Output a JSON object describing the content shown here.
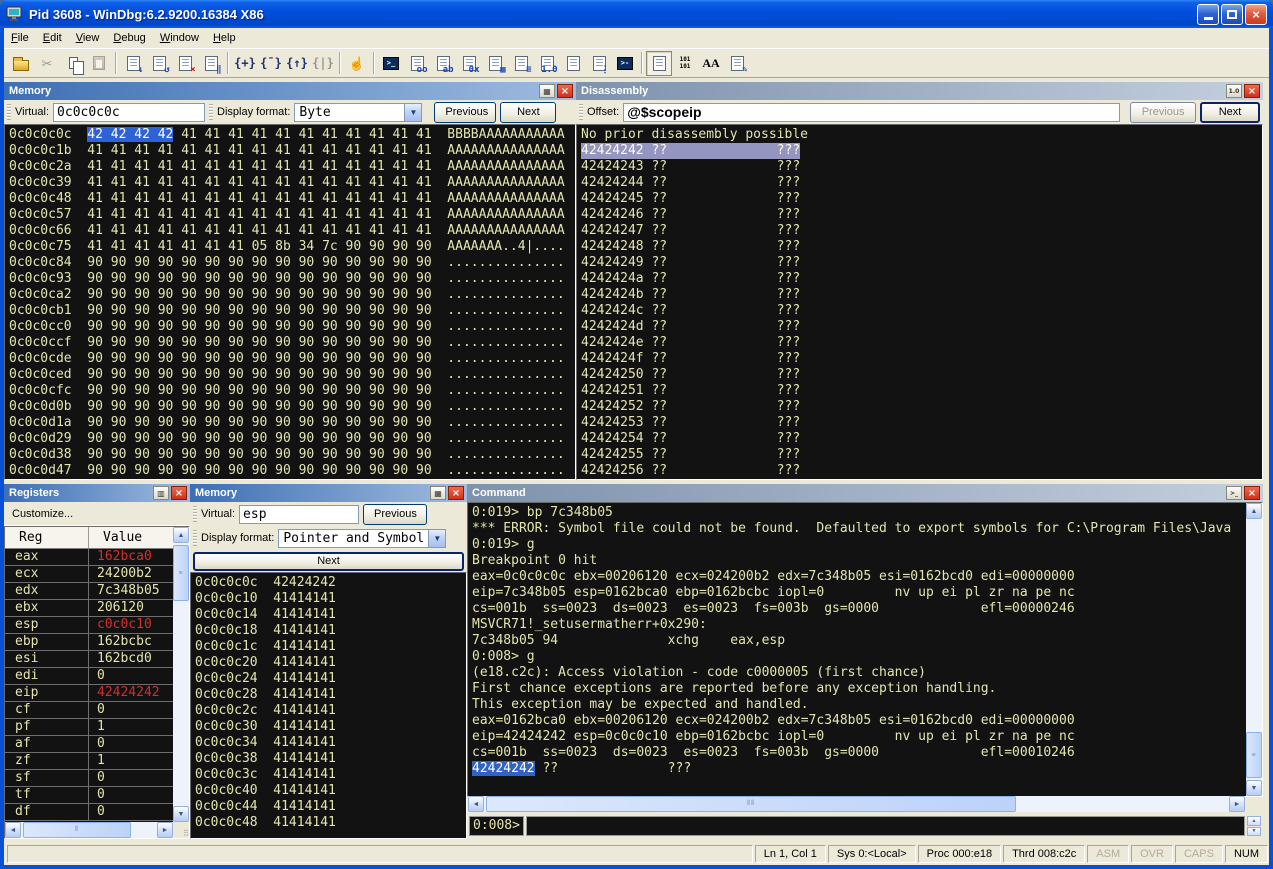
{
  "colors": {
    "frame_blue": "#0851d6",
    "content_bg": "#121212",
    "content_fg": "#e4e4ae",
    "sel_blue": "#2e63d8",
    "disasm_hl": "#9595c1",
    "cmd_sel": "#3163c6",
    "value_red": "#d22f2f",
    "pane_active_1": "#3d6fb4",
    "pane_active_2": "#9fbce0",
    "pane_inactive_1": "#7e92ad",
    "pane_inactive_2": "#c3cfdd"
  },
  "window": {
    "title": "Pid 3608 - WinDbg:6.2.9200.16384 X86",
    "buttons": {
      "minimize": "minimize",
      "maximize": "maximize",
      "close": "close"
    }
  },
  "menu": {
    "items": [
      {
        "label": "File"
      },
      {
        "label": "Edit"
      },
      {
        "label": "View"
      },
      {
        "label": "Debug"
      },
      {
        "label": "Window"
      },
      {
        "label": "Help"
      }
    ]
  },
  "toolbar": {
    "items": [
      {
        "name": "open-source-file",
        "type": "folder"
      },
      {
        "name": "cut",
        "type": "glyph",
        "glyph": "✂",
        "disabled": true
      },
      {
        "name": "copy",
        "type": "copy"
      },
      {
        "name": "paste",
        "type": "paste",
        "disabled": true
      },
      {
        "sep": true
      },
      {
        "name": "go",
        "type": "doc",
        "glyph": "↓"
      },
      {
        "name": "restart",
        "type": "doc",
        "glyph": "↺"
      },
      {
        "name": "stop-debugging",
        "type": "doc",
        "glyph": "×",
        "red": true
      },
      {
        "name": "break",
        "type": "doc",
        "glyph": "‖"
      },
      {
        "sep": true
      },
      {
        "name": "step-into",
        "type": "brace",
        "glyph": "{+}"
      },
      {
        "name": "step-over",
        "type": "brace",
        "glyph": "{¯}"
      },
      {
        "name": "step-out",
        "type": "brace",
        "glyph": "{↑}"
      },
      {
        "name": "run-to-cursor",
        "type": "brace",
        "glyph": "{|}",
        "disabled": true
      },
      {
        "sep": true
      },
      {
        "name": "break-hand",
        "type": "glyph",
        "glyph": "☝"
      },
      {
        "sep": true
      },
      {
        "name": "command-window",
        "type": "dark",
        "glyph": ">_"
      },
      {
        "name": "watch-window",
        "type": "doc",
        "glyph": "oo"
      },
      {
        "name": "locals-window",
        "type": "doc",
        "glyph": "ab"
      },
      {
        "name": "registers-window",
        "type": "doc",
        "glyph": "0x"
      },
      {
        "name": "memory-window",
        "type": "doc",
        "glyph": "▦"
      },
      {
        "name": "call-stack-window",
        "type": "doc",
        "glyph": "≡"
      },
      {
        "name": "disassembly-window",
        "type": "doc",
        "glyph": "1.0"
      },
      {
        "name": "scratch-pad-window",
        "type": "doc",
        "glyph": ""
      },
      {
        "name": "processes-window",
        "type": "doc",
        "glyph": "⋮"
      },
      {
        "name": "command-browser-window",
        "type": "dark",
        "glyph": ">-"
      },
      {
        "sep": true
      },
      {
        "name": "source-mode-on",
        "type": "doc",
        "glyph": "",
        "pressed": true
      },
      {
        "name": "source-mode-off",
        "type": "101",
        "glyph": "101\n101"
      },
      {
        "name": "font",
        "type": "font",
        "glyph": "AA"
      },
      {
        "name": "options",
        "type": "doc",
        "glyph": "✎"
      }
    ]
  },
  "memory1": {
    "title": "Memory",
    "toolbar": {
      "virtual_label": "Virtual:",
      "virtual_value": "0c0c0c0c",
      "format_label": "Display format:",
      "format_value": "Byte",
      "prev_label": "Previous",
      "next_label": "Next"
    },
    "rows": [
      {
        "addr": "0c0c0c0c",
        "sel": "42 42 42 42",
        "bytes": "41 41 41 41 41 41 41 41 41 41 41",
        "ascii": "BBBBAAAAAAAAAAA"
      },
      {
        "addr": "0c0c0c1b",
        "bytes": "41 41 41 41 41 41 41 41 41 41 41 41 41 41 41",
        "ascii": "AAAAAAAAAAAAAAA"
      },
      {
        "addr": "0c0c0c2a",
        "bytes": "41 41 41 41 41 41 41 41 41 41 41 41 41 41 41",
        "ascii": "AAAAAAAAAAAAAAA"
      },
      {
        "addr": "0c0c0c39",
        "bytes": "41 41 41 41 41 41 41 41 41 41 41 41 41 41 41",
        "ascii": "AAAAAAAAAAAAAAA"
      },
      {
        "addr": "0c0c0c48",
        "bytes": "41 41 41 41 41 41 41 41 41 41 41 41 41 41 41",
        "ascii": "AAAAAAAAAAAAAAA"
      },
      {
        "addr": "0c0c0c57",
        "bytes": "41 41 41 41 41 41 41 41 41 41 41 41 41 41 41",
        "ascii": "AAAAAAAAAAAAAAA"
      },
      {
        "addr": "0c0c0c66",
        "bytes": "41 41 41 41 41 41 41 41 41 41 41 41 41 41 41",
        "ascii": "AAAAAAAAAAAAAAA"
      },
      {
        "addr": "0c0c0c75",
        "bytes": "41 41 41 41 41 41 41 05 8b 34 7c 90 90 90 90",
        "ascii": "AAAAAAA..4|...."
      },
      {
        "addr": "0c0c0c84",
        "bytes": "90 90 90 90 90 90 90 90 90 90 90 90 90 90 90",
        "ascii": "..............."
      },
      {
        "addr": "0c0c0c93",
        "bytes": "90 90 90 90 90 90 90 90 90 90 90 90 90 90 90",
        "ascii": "..............."
      },
      {
        "addr": "0c0c0ca2",
        "bytes": "90 90 90 90 90 90 90 90 90 90 90 90 90 90 90",
        "ascii": "..............."
      },
      {
        "addr": "0c0c0cb1",
        "bytes": "90 90 90 90 90 90 90 90 90 90 90 90 90 90 90",
        "ascii": "..............."
      },
      {
        "addr": "0c0c0cc0",
        "bytes": "90 90 90 90 90 90 90 90 90 90 90 90 90 90 90",
        "ascii": "..............."
      },
      {
        "addr": "0c0c0ccf",
        "bytes": "90 90 90 90 90 90 90 90 90 90 90 90 90 90 90",
        "ascii": "..............."
      },
      {
        "addr": "0c0c0cde",
        "bytes": "90 90 90 90 90 90 90 90 90 90 90 90 90 90 90",
        "ascii": "..............."
      },
      {
        "addr": "0c0c0ced",
        "bytes": "90 90 90 90 90 90 90 90 90 90 90 90 90 90 90",
        "ascii": "..............."
      },
      {
        "addr": "0c0c0cfc",
        "bytes": "90 90 90 90 90 90 90 90 90 90 90 90 90 90 90",
        "ascii": "..............."
      },
      {
        "addr": "0c0c0d0b",
        "bytes": "90 90 90 90 90 90 90 90 90 90 90 90 90 90 90",
        "ascii": "..............."
      },
      {
        "addr": "0c0c0d1a",
        "bytes": "90 90 90 90 90 90 90 90 90 90 90 90 90 90 90",
        "ascii": "..............."
      },
      {
        "addr": "0c0c0d29",
        "bytes": "90 90 90 90 90 90 90 90 90 90 90 90 90 90 90",
        "ascii": "..............."
      },
      {
        "addr": "0c0c0d38",
        "bytes": "90 90 90 90 90 90 90 90 90 90 90 90 90 90 90",
        "ascii": "..............."
      },
      {
        "addr": "0c0c0d47",
        "bytes": "90 90 90 90 90 90 90 90 90 90 90 90 90 90 90",
        "ascii": "..............."
      }
    ]
  },
  "disasm": {
    "title": "Disassembly",
    "toolbar": {
      "offset_label": "Offset:",
      "offset_value": "@$scopeip",
      "prev_label": "Previous",
      "next_label": "Next"
    },
    "note": "No prior disassembly possible",
    "rows": [
      {
        "addr": "42424242",
        "bytes": "??",
        "instr": "???"
      },
      {
        "addr": "42424243",
        "bytes": "??",
        "instr": "???"
      },
      {
        "addr": "42424244",
        "bytes": "??",
        "instr": "???"
      },
      {
        "addr": "42424245",
        "bytes": "??",
        "instr": "???"
      },
      {
        "addr": "42424246",
        "bytes": "??",
        "instr": "???"
      },
      {
        "addr": "42424247",
        "bytes": "??",
        "instr": "???"
      },
      {
        "addr": "42424248",
        "bytes": "??",
        "instr": "???"
      },
      {
        "addr": "42424249",
        "bytes": "??",
        "instr": "???"
      },
      {
        "addr": "4242424a",
        "bytes": "??",
        "instr": "???"
      },
      {
        "addr": "4242424b",
        "bytes": "??",
        "instr": "???"
      },
      {
        "addr": "4242424c",
        "bytes": "??",
        "instr": "???"
      },
      {
        "addr": "4242424d",
        "bytes": "??",
        "instr": "???"
      },
      {
        "addr": "4242424e",
        "bytes": "??",
        "instr": "???"
      },
      {
        "addr": "4242424f",
        "bytes": "??",
        "instr": "???"
      },
      {
        "addr": "42424250",
        "bytes": "??",
        "instr": "???"
      },
      {
        "addr": "42424251",
        "bytes": "??",
        "instr": "???"
      },
      {
        "addr": "42424252",
        "bytes": "??",
        "instr": "???"
      },
      {
        "addr": "42424253",
        "bytes": "??",
        "instr": "???"
      },
      {
        "addr": "42424254",
        "bytes": "??",
        "instr": "???"
      },
      {
        "addr": "42424255",
        "bytes": "??",
        "instr": "???"
      },
      {
        "addr": "42424256",
        "bytes": "??",
        "instr": "???"
      }
    ]
  },
  "registers": {
    "title": "Registers",
    "customize_label": "Customize...",
    "headers": {
      "reg": "Reg",
      "value": "Value"
    },
    "rows": [
      {
        "reg": "eax",
        "value": "162bca0",
        "red": true
      },
      {
        "reg": "ecx",
        "value": "24200b2"
      },
      {
        "reg": "edx",
        "value": "7c348b05"
      },
      {
        "reg": "ebx",
        "value": "206120"
      },
      {
        "reg": "esp",
        "value": "c0c0c10",
        "red": true
      },
      {
        "reg": "ebp",
        "value": "162bcbc"
      },
      {
        "reg": "esi",
        "value": "162bcd0"
      },
      {
        "reg": "edi",
        "value": "0"
      },
      {
        "reg": "eip",
        "value": "42424242",
        "red": true
      },
      {
        "reg": "cf",
        "value": "0"
      },
      {
        "reg": "pf",
        "value": "1"
      },
      {
        "reg": "af",
        "value": "0"
      },
      {
        "reg": "zf",
        "value": "1"
      },
      {
        "reg": "sf",
        "value": "0"
      },
      {
        "reg": "tf",
        "value": "0"
      },
      {
        "reg": "df",
        "value": "0"
      }
    ]
  },
  "memory2": {
    "title": "Memory",
    "toolbar": {
      "virtual_label": "Virtual:",
      "virtual_value": "esp",
      "format_label": "Display format:",
      "format_value": "Pointer and Symbol",
      "prev_label": "Previous",
      "next_label": "Next"
    },
    "rows": [
      {
        "addr": "0c0c0c0c",
        "value": "42424242"
      },
      {
        "addr": "0c0c0c10",
        "value": "41414141"
      },
      {
        "addr": "0c0c0c14",
        "value": "41414141"
      },
      {
        "addr": "0c0c0c18",
        "value": "41414141"
      },
      {
        "addr": "0c0c0c1c",
        "value": "41414141"
      },
      {
        "addr": "0c0c0c20",
        "value": "41414141"
      },
      {
        "addr": "0c0c0c24",
        "value": "41414141"
      },
      {
        "addr": "0c0c0c28",
        "value": "41414141"
      },
      {
        "addr": "0c0c0c2c",
        "value": "41414141"
      },
      {
        "addr": "0c0c0c30",
        "value": "41414141"
      },
      {
        "addr": "0c0c0c34",
        "value": "41414141"
      },
      {
        "addr": "0c0c0c38",
        "value": "41414141"
      },
      {
        "addr": "0c0c0c3c",
        "value": "41414141"
      },
      {
        "addr": "0c0c0c40",
        "value": "41414141"
      },
      {
        "addr": "0c0c0c44",
        "value": "41414141"
      },
      {
        "addr": "0c0c0c48",
        "value": "41414141"
      }
    ]
  },
  "command": {
    "title": "Command",
    "prompt": "0:008>",
    "lines": [
      {
        "text": "0:019> bp 7c348b05"
      },
      {
        "text": "*** ERROR: Symbol file could not be found.  Defaulted to export symbols for C:\\Program Files\\Java"
      },
      {
        "text": "0:019> g"
      },
      {
        "text": "Breakpoint 0 hit"
      },
      {
        "text": "eax=0c0c0c0c ebx=00206120 ecx=024200b2 edx=7c348b05 esi=0162bcd0 edi=00000000"
      },
      {
        "text": "eip=7c348b05 esp=0162bca0 ebp=0162bcbc iopl=0         nv up ei pl zr na pe nc"
      },
      {
        "text": "cs=001b  ss=0023  ds=0023  es=0023  fs=003b  gs=0000             efl=00000246"
      },
      {
        "text": "MSVCR71!_setusermatherr+0x290:"
      },
      {
        "text": "7c348b05 94              xchg    eax,esp"
      },
      {
        "text": "0:008> g"
      },
      {
        "text": "(e18.c2c): Access violation - code c0000005 (first chance)"
      },
      {
        "text": "First chance exceptions are reported before any exception handling."
      },
      {
        "text": "This exception may be expected and handled."
      },
      {
        "text": "eax=0162bca0 ebx=00206120 ecx=024200b2 edx=7c348b05 esi=0162bcd0 edi=00000000"
      },
      {
        "text": "eip=42424242 esp=0c0c0c10 ebp=0162bcbc iopl=0         nv up ei pl zr na pe nc"
      },
      {
        "text": "cs=001b  ss=0023  ds=0023  es=0023  fs=003b  gs=0000             efl=00010246"
      },
      {
        "text": "42424242 ??              ???",
        "highlight": "42424242"
      }
    ]
  },
  "statusbar": {
    "cells": [
      {
        "label": "Ln 1, Col 1"
      },
      {
        "label": "Sys 0:<Local>"
      },
      {
        "label": "Proc 000:e18"
      },
      {
        "label": "Thrd 008:c2c"
      },
      {
        "label": "ASM",
        "disabled": true
      },
      {
        "label": "OVR",
        "disabled": true
      },
      {
        "label": "CAPS",
        "disabled": true
      },
      {
        "label": "NUM"
      }
    ]
  }
}
